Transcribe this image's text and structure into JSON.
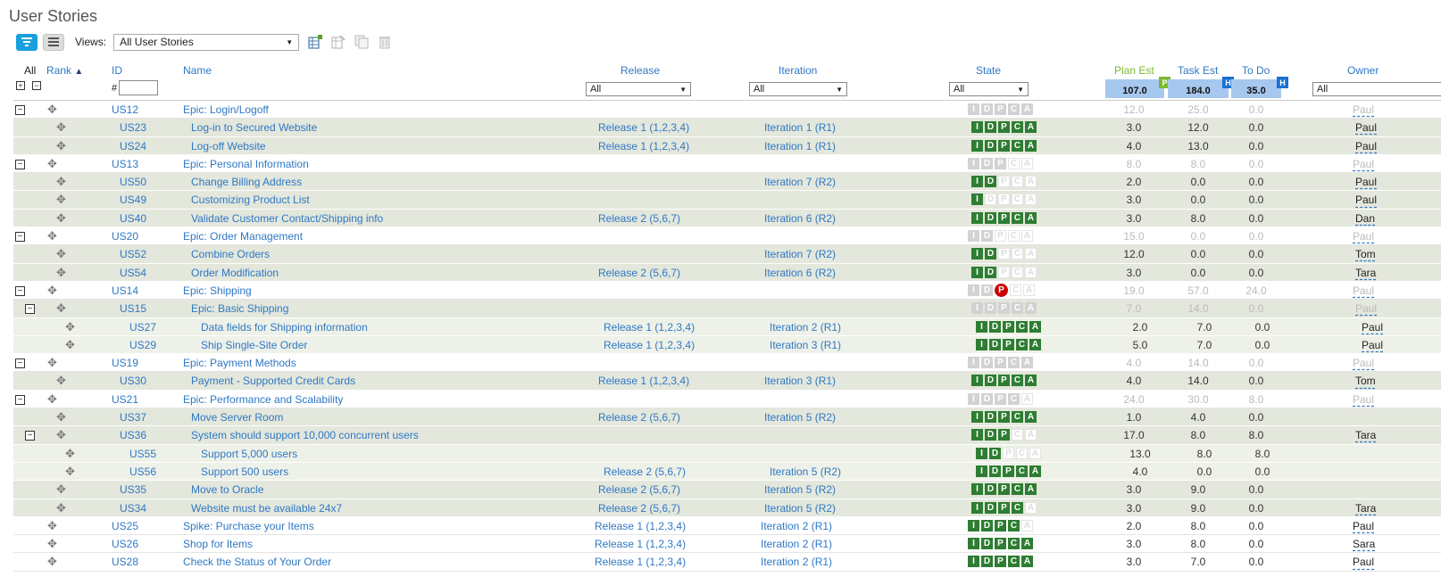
{
  "page_title": "User Stories",
  "views": {
    "label": "Views:",
    "selected": "All User Stories"
  },
  "columns": {
    "all": "All",
    "rank": "Rank",
    "id": "ID",
    "name": "Name",
    "release": "Release",
    "iteration": "Iteration",
    "state": "State",
    "plan_est": "Plan Est",
    "task_est": "Task Est",
    "todo": "To Do",
    "owner": "Owner"
  },
  "filters": {
    "id_prefix": "#",
    "release": "All",
    "iteration": "All",
    "state": "All",
    "owner": "All",
    "plan_total": "107.0",
    "task_total": "184.0",
    "todo_total": "35.0",
    "plan_tag": "P",
    "task_tag": "H",
    "todo_tag": "H"
  },
  "state_letters": [
    "I",
    "D",
    "P",
    "C",
    "A"
  ],
  "colors": {
    "state_done": "#2e7d32",
    "link": "#2f78c4",
    "total_bg": "#a7c8ee",
    "row_shade": "#e3e7dc"
  },
  "rows": [
    {
      "level": 0,
      "toggle": "-",
      "id": "US12",
      "name": "Epic: Login/Logoff",
      "release": "",
      "iteration": "",
      "states": "ggggg",
      "plan": "12.0",
      "task": "25.0",
      "todo": "0.0",
      "owner": "Paul",
      "dim": true,
      "bg": "l0"
    },
    {
      "level": 1,
      "toggle": "",
      "id": "US23",
      "name": "Log-in to Secured Website",
      "release": "Release 1 (1,2,3,4)",
      "iteration": "Iteration 1 (R1)",
      "states": "nnnnn",
      "plan": "3.0",
      "task": "12.0",
      "todo": "0.0",
      "owner": "Paul",
      "dim": false,
      "bg": "l1"
    },
    {
      "level": 1,
      "toggle": "",
      "id": "US24",
      "name": "Log-off Website",
      "release": "Release 1 (1,2,3,4)",
      "iteration": "Iteration 1 (R1)",
      "states": "nnnnn",
      "plan": "4.0",
      "task": "13.0",
      "todo": "0.0",
      "owner": "Paul",
      "dim": false,
      "bg": "l1"
    },
    {
      "level": 0,
      "toggle": "-",
      "id": "US13",
      "name": "Epic: Personal Information",
      "release": "",
      "iteration": "",
      "states": "gggoo",
      "plan": "8.0",
      "task": "8.0",
      "todo": "0.0",
      "owner": "Paul",
      "dim": true,
      "bg": "l0"
    },
    {
      "level": 1,
      "toggle": "",
      "id": "US50",
      "name": "Change Billing Address",
      "release": "",
      "iteration": "Iteration 7 (R2)",
      "states": "nnooo",
      "plan": "2.0",
      "task": "0.0",
      "todo": "0.0",
      "owner": "Paul",
      "dim": false,
      "bg": "l1"
    },
    {
      "level": 1,
      "toggle": "",
      "id": "US49",
      "name": "Customizing Product List",
      "release": "",
      "iteration": "",
      "states": "noooo",
      "plan": "3.0",
      "task": "0.0",
      "todo": "0.0",
      "owner": "Paul",
      "dim": false,
      "bg": "l1"
    },
    {
      "level": 1,
      "toggle": "",
      "id": "US40",
      "name": "Validate Customer Contact/Shipping info",
      "release": "Release 2 (5,6,7)",
      "iteration": "Iteration 6 (R2)",
      "states": "nnnnn",
      "plan": "3.0",
      "task": "8.0",
      "todo": "0.0",
      "owner": "Dan",
      "dim": false,
      "bg": "l1"
    },
    {
      "level": 0,
      "toggle": "-",
      "id": "US20",
      "name": "Epic: Order Management",
      "release": "",
      "iteration": "",
      "states": "ggooo",
      "plan": "15.0",
      "task": "0.0",
      "todo": "0.0",
      "owner": "Paul",
      "dim": true,
      "bg": "l0"
    },
    {
      "level": 1,
      "toggle": "",
      "id": "US52",
      "name": "Combine Orders",
      "release": "",
      "iteration": "Iteration 7 (R2)",
      "states": "nnooo",
      "plan": "12.0",
      "task": "0.0",
      "todo": "0.0",
      "owner": "Tom",
      "dim": false,
      "bg": "l1"
    },
    {
      "level": 1,
      "toggle": "",
      "id": "US54",
      "name": "Order Modification",
      "release": "Release 2 (5,6,7)",
      "iteration": "Iteration 6 (R2)",
      "states": "nnooo",
      "plan": "3.0",
      "task": "0.0",
      "todo": "0.0",
      "owner": "Tara",
      "dim": false,
      "bg": "l1"
    },
    {
      "level": 0,
      "toggle": "-",
      "id": "US14",
      "name": "Epic: Shipping",
      "release": "",
      "iteration": "",
      "states": "ggroo",
      "plan": "19.0",
      "task": "57.0",
      "todo": "24.0",
      "owner": "Paul",
      "dim": true,
      "bg": "l0"
    },
    {
      "level": 1,
      "toggle": "-",
      "id": "US15",
      "name": "Epic: Basic Shipping",
      "release": "",
      "iteration": "",
      "states": "ggggg",
      "plan": "7.0",
      "task": "14.0",
      "todo": "0.0",
      "owner": "Paul",
      "dim": true,
      "bg": "l1"
    },
    {
      "level": 2,
      "toggle": "",
      "id": "US27",
      "name": "Data fields for Shipping information",
      "release": "Release 1 (1,2,3,4)",
      "iteration": "Iteration 2 (R1)",
      "states": "nnnnn",
      "plan": "2.0",
      "task": "7.0",
      "todo": "0.0",
      "owner": "Paul",
      "dim": false,
      "bg": "l2"
    },
    {
      "level": 2,
      "toggle": "",
      "id": "US29",
      "name": "Ship Single-Site Order",
      "release": "Release 1 (1,2,3,4)",
      "iteration": "Iteration 3 (R1)",
      "states": "nnnnn",
      "plan": "5.0",
      "task": "7.0",
      "todo": "0.0",
      "owner": "Paul",
      "dim": false,
      "bg": "l2"
    },
    {
      "level": 0,
      "toggle": "-",
      "id": "US19",
      "name": "Epic: Payment Methods",
      "release": "",
      "iteration": "",
      "states": "ggggg",
      "plan": "4.0",
      "task": "14.0",
      "todo": "0.0",
      "owner": "Paul",
      "dim": true,
      "bg": "l0"
    },
    {
      "level": 1,
      "toggle": "",
      "id": "US30",
      "name": "Payment - Supported Credit Cards",
      "release": "Release 1 (1,2,3,4)",
      "iteration": "Iteration 3 (R1)",
      "states": "nnnnn",
      "plan": "4.0",
      "task": "14.0",
      "todo": "0.0",
      "owner": "Tom",
      "dim": false,
      "bg": "l1"
    },
    {
      "level": 0,
      "toggle": "-",
      "id": "US21",
      "name": "Epic: Performance and Scalability",
      "release": "",
      "iteration": "",
      "states": "ggggo",
      "plan": "24.0",
      "task": "30.0",
      "todo": "8.0",
      "owner": "Paul",
      "dim": true,
      "bg": "l0"
    },
    {
      "level": 1,
      "toggle": "",
      "id": "US37",
      "name": "Move Server Room",
      "release": "Release 2 (5,6,7)",
      "iteration": "Iteration 5 (R2)",
      "states": "nnnnn",
      "plan": "1.0",
      "task": "4.0",
      "todo": "0.0",
      "owner": "",
      "dim": false,
      "bg": "l1"
    },
    {
      "level": 1,
      "toggle": "-",
      "id": "US36",
      "name": "System should support 10,000 concurrent users",
      "release": "",
      "iteration": "",
      "states": "nnnoo",
      "plan": "17.0",
      "task": "8.0",
      "todo": "8.0",
      "owner": "Tara",
      "dim": false,
      "bg": "l1"
    },
    {
      "level": 2,
      "toggle": "",
      "id": "US55",
      "name": "Support 5,000 users",
      "release": "",
      "iteration": "",
      "states": "nnooo",
      "plan": "13.0",
      "task": "8.0",
      "todo": "8.0",
      "owner": "",
      "dim": false,
      "bg": "l2"
    },
    {
      "level": 2,
      "toggle": "",
      "id": "US56",
      "name": "Support 500 users",
      "release": "Release 2 (5,6,7)",
      "iteration": "Iteration 5 (R2)",
      "states": "nnnnn",
      "plan": "4.0",
      "task": "0.0",
      "todo": "0.0",
      "owner": "",
      "dim": false,
      "bg": "l2"
    },
    {
      "level": 1,
      "toggle": "",
      "id": "US35",
      "name": "Move to Oracle",
      "release": "Release 2 (5,6,7)",
      "iteration": "Iteration 5 (R2)",
      "states": "nnnnn",
      "plan": "3.0",
      "task": "9.0",
      "todo": "0.0",
      "owner": "",
      "dim": false,
      "bg": "l1"
    },
    {
      "level": 1,
      "toggle": "",
      "id": "US34",
      "name": "Website must be available 24x7",
      "release": "Release 2 (5,6,7)",
      "iteration": "Iteration 5 (R2)",
      "states": "nnnno",
      "plan": "3.0",
      "task": "9.0",
      "todo": "0.0",
      "owner": "Tara",
      "dim": false,
      "bg": "l1"
    },
    {
      "level": 0,
      "toggle": "",
      "id": "US25",
      "name": "Spike: Purchase your Items",
      "release": "Release 1 (1,2,3,4)",
      "iteration": "Iteration 2 (R1)",
      "states": "nnnno",
      "plan": "2.0",
      "task": "8.0",
      "todo": "0.0",
      "owner": "Paul",
      "dim": false,
      "bg": "plain"
    },
    {
      "level": 0,
      "toggle": "",
      "id": "US26",
      "name": "Shop for Items",
      "release": "Release 1 (1,2,3,4)",
      "iteration": "Iteration 2 (R1)",
      "states": "nnnnn",
      "plan": "3.0",
      "task": "8.0",
      "todo": "0.0",
      "owner": "Sara",
      "dim": false,
      "bg": "plain"
    },
    {
      "level": 0,
      "toggle": "",
      "id": "US28",
      "name": "Check the Status of Your Order",
      "release": "Release 1 (1,2,3,4)",
      "iteration": "Iteration 2 (R1)",
      "states": "nnnnn",
      "plan": "3.0",
      "task": "7.0",
      "todo": "0.0",
      "owner": "Paul",
      "dim": false,
      "bg": "plain"
    }
  ]
}
